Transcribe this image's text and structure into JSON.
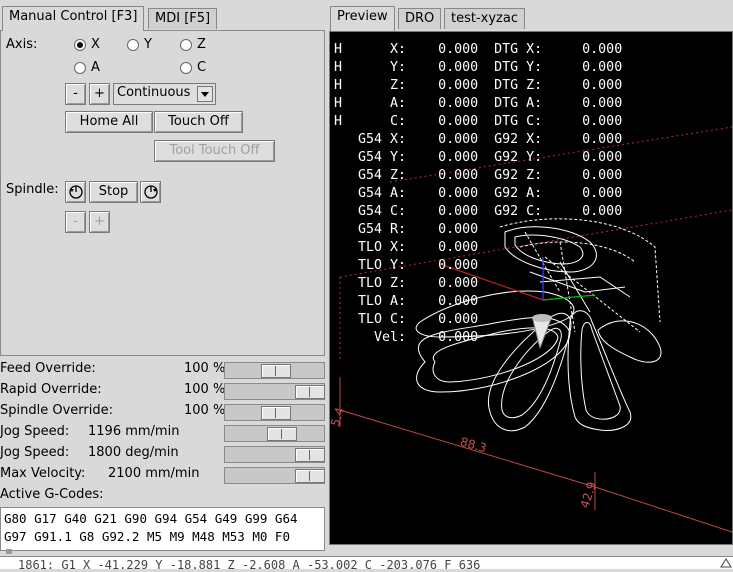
{
  "left_tabs": [
    {
      "label": "Manual Control [F3]",
      "active": true
    },
    {
      "label": "MDI [F5]",
      "active": false
    }
  ],
  "axis": {
    "label": "Axis:",
    "options": [
      {
        "label": "X",
        "selected": true
      },
      {
        "label": "Y",
        "selected": false
      },
      {
        "label": "Z",
        "selected": false
      },
      {
        "label": "A",
        "selected": false
      },
      {
        "label": "C",
        "selected": false
      }
    ]
  },
  "jog": {
    "minus": "-",
    "plus": "+",
    "mode": "Continuous"
  },
  "buttons": {
    "home_all": "Home All",
    "touch_off": "Touch Off",
    "tool_touch_off": "Tool Touch Off"
  },
  "spindle": {
    "label": "Spindle:",
    "stop": "Stop",
    "minus": "-",
    "plus": "+"
  },
  "overrides": [
    {
      "label": "Feed Override:",
      "value": "100 %",
      "level": 0.5
    },
    {
      "label": "Rapid Override:",
      "value": "100 %",
      "level": 1.0
    },
    {
      "label": "Spindle Override:",
      "value": "100 %",
      "level": 0.5
    },
    {
      "label": "Jog Speed:",
      "value": "1196 mm/min",
      "level": 0.6
    },
    {
      "label": "Jog Speed:",
      "value": "1800 deg/min",
      "level": 1.0
    },
    {
      "label": "Max Velocity:",
      "value": "2100 mm/min",
      "level": 1.0
    }
  ],
  "gcodes": {
    "label": "Active G-Codes:",
    "line1": "G80 G17 G40 G21 G90 G94 G54 G49 G99 G64",
    "line2": "G97 G91.1 G8 G92.2 M5 M9 M48 M53 M0 F0"
  },
  "right_tabs": [
    {
      "label": "Preview",
      "active": true
    },
    {
      "label": "DRO",
      "active": false
    },
    {
      "label": "test-xyzac",
      "active": false
    }
  ],
  "dro_lines": [
    "H      X:    0.000  DTG X:     0.000",
    "H      Y:    0.000  DTG Y:     0.000",
    "H      Z:    0.000  DTG Z:     0.000",
    "H      A:    0.000  DTG A:     0.000",
    "H      C:    0.000  DTG C:     0.000",
    "   G54 X:    0.000  G92 X:     0.000",
    "   G54 Y:    0.000  G92 Y:     0.000",
    "   G54 Z:    0.000  G92 Z:     0.000",
    "   G54 A:    0.000  G92 A:     0.000",
    "   G54 C:    0.000  G92 C:     0.000",
    "   G54 R:    0.000",
    "   TLO X:    0.000",
    "   TLO Y:    0.000",
    "   TLO Z:    0.000",
    "   TLO A:    0.000",
    "   TLO C:    0.000",
    "     Vel:    0.000"
  ],
  "dims": {
    "d1": "88.3",
    "d2": "42.9",
    "d3": "5.4"
  },
  "status_line": "1861: G1  X -41.229  Y -18.881  Z -2.608  A -53.002  C -203.076  F 636"
}
